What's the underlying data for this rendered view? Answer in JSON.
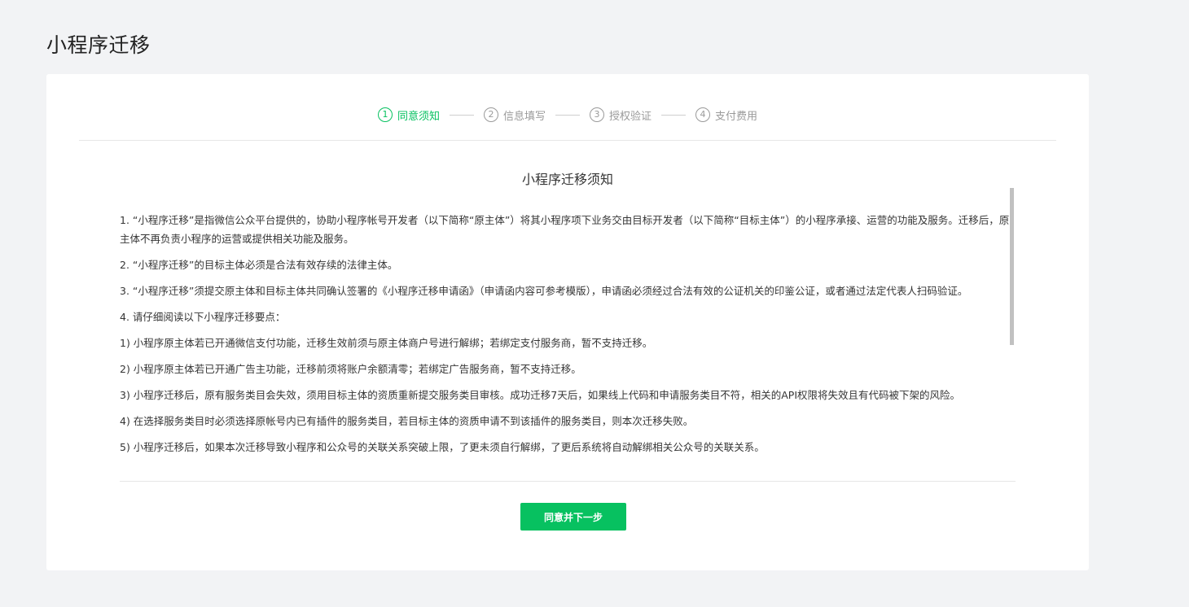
{
  "page": {
    "title": "小程序迁移"
  },
  "stepper": {
    "steps": [
      {
        "num": "1",
        "label": "同意须知",
        "active": true
      },
      {
        "num": "2",
        "label": "信息填写",
        "active": false
      },
      {
        "num": "3",
        "label": "授权验证",
        "active": false
      },
      {
        "num": "4",
        "label": "支付费用",
        "active": false
      }
    ]
  },
  "notice": {
    "title": "小程序迁移须知",
    "paragraphs": [
      "1. “小程序迁移”是指微信公众平台提供的，协助小程序帐号开发者（以下简称“原主体”）将其小程序项下业务交由目标开发者（以下简称“目标主体”）的小程序承接、运营的功能及服务。迁移后，原主体不再负责小程序的运营或提供相关功能及服务。",
      "2. “小程序迁移”的目标主体必须是合法有效存续的法律主体。",
      "3. “小程序迁移”须提交原主体和目标主体共同确认签署的《小程序迁移申请函》（申请函内容可参考模版），申请函必须经过合法有效的公证机关的印鉴公证，或者通过法定代表人扫码验证。",
      "4. 请仔细阅读以下小程序迁移要点：",
      "1) 小程序原主体若已开通微信支付功能，迁移生效前须与原主体商户号进行解绑；若绑定支付服务商，暂不支持迁移。",
      "2) 小程序原主体若已开通广告主功能，迁移前须将账户余额清零；若绑定广告服务商，暂不支持迁移。",
      "3) 小程序迁移后，原有服务类目会失效，须用目标主体的资质重新提交服务类目审核。成功迁移7天后，如果线上代码和申请服务类目不符，相关的API权限将失效且有代码被下架的风险。",
      "4) 在选择服务类目时必须选择原帐号内已有插件的服务类目，若目标主体的资质申请不到该插件的服务类目，则本次迁移失败。",
      "5) 小程序迁移后，如果本次迁移导致小程序和公众号的关联关系突破上限，了更未须自行解绑，了更后系统将自动解绑相关公众号的关联关系。"
    ]
  },
  "actions": {
    "agree_label": "同意并下一步"
  },
  "colors": {
    "accent": "#07c160",
    "background": "#f2f3f5",
    "card": "#ffffff"
  }
}
